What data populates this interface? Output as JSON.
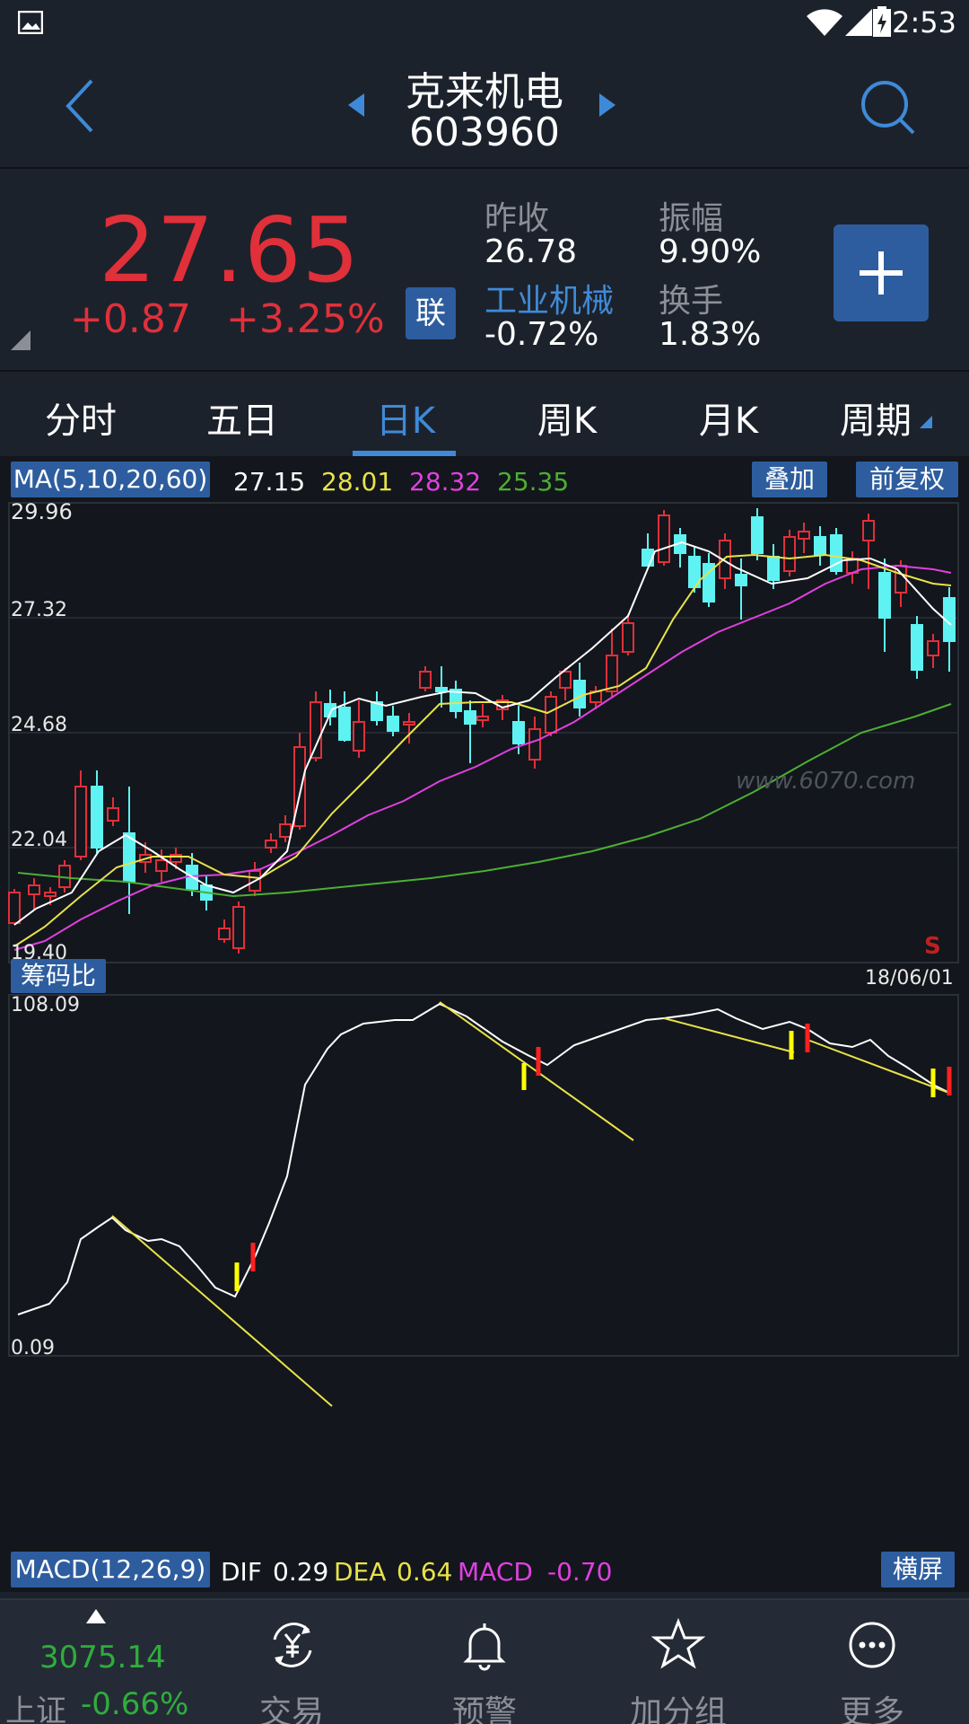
{
  "status_bar": {
    "time": "2:53"
  },
  "header": {
    "title": "克来机电",
    "code": "603960"
  },
  "quote": {
    "price": "27.65",
    "change": "+0.87",
    "change_pct": "+3.25%",
    "link_badge": "联",
    "prev_close_label": "昨收",
    "prev_close": "26.78",
    "amplitude_label": "振幅",
    "amplitude": "9.90%",
    "sector_label": "工业机械",
    "sector_change": "-0.72%",
    "turnover_label": "换手",
    "turnover": "1.83%"
  },
  "tabs": [
    {
      "label": "分时"
    },
    {
      "label": "五日"
    },
    {
      "label": "日K"
    },
    {
      "label": "周K"
    },
    {
      "label": "月K"
    },
    {
      "label": "周期"
    }
  ],
  "ma_legend": {
    "label": "MA(5,10,20,60)",
    "ma5": "27.15",
    "ma10": "28.01",
    "ma20": "28.32",
    "ma60": "25.35",
    "overlay_button": "叠加",
    "adjust_button": "前复权"
  },
  "price_axis": [
    "29.96",
    "27.32",
    "24.68",
    "22.04",
    "19.40"
  ],
  "watermark": "www.6070.com",
  "signal_marker": "S",
  "date_label": "18/06/01",
  "indicator": {
    "label": "筹码比",
    "max": "108.09",
    "min": "0.09"
  },
  "macd": {
    "label": "MACD(12,26,9)",
    "dif_label": "DIF",
    "dif": "0.29",
    "dea_label": "DEA",
    "dea": "0.64",
    "macd_label": "MACD",
    "macd": "-0.70",
    "landscape_button": "横屏"
  },
  "bottom_nav": {
    "index_value": "3075.14",
    "index_name": "上证",
    "index_change": "-0.66%",
    "items": [
      {
        "label": "交易",
        "icon": "yen-exchange-icon"
      },
      {
        "label": "预警",
        "icon": "bell-icon"
      },
      {
        "label": "加分组",
        "icon": "star-icon"
      },
      {
        "label": "更多",
        "icon": "more-icon"
      }
    ]
  },
  "colors": {
    "up": "#e0303a",
    "down": "#5ef2f2",
    "ma5": "#ffffff",
    "ma10": "#e8e24a",
    "ma20": "#e040e0",
    "ma60": "#4caf32",
    "accent": "#2d5d9e"
  }
}
